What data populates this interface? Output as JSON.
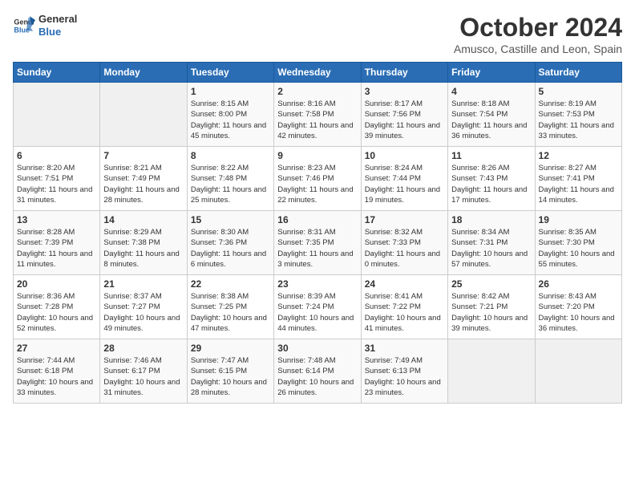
{
  "header": {
    "logo_general": "General",
    "logo_blue": "Blue",
    "month": "October 2024",
    "location": "Amusco, Castille and Leon, Spain"
  },
  "days_of_week": [
    "Sunday",
    "Monday",
    "Tuesday",
    "Wednesday",
    "Thursday",
    "Friday",
    "Saturday"
  ],
  "weeks": [
    [
      {
        "day": "",
        "sunrise": "",
        "sunset": "",
        "daylight": ""
      },
      {
        "day": "",
        "sunrise": "",
        "sunset": "",
        "daylight": ""
      },
      {
        "day": "1",
        "sunrise": "Sunrise: 8:15 AM",
        "sunset": "Sunset: 8:00 PM",
        "daylight": "Daylight: 11 hours and 45 minutes."
      },
      {
        "day": "2",
        "sunrise": "Sunrise: 8:16 AM",
        "sunset": "Sunset: 7:58 PM",
        "daylight": "Daylight: 11 hours and 42 minutes."
      },
      {
        "day": "3",
        "sunrise": "Sunrise: 8:17 AM",
        "sunset": "Sunset: 7:56 PM",
        "daylight": "Daylight: 11 hours and 39 minutes."
      },
      {
        "day": "4",
        "sunrise": "Sunrise: 8:18 AM",
        "sunset": "Sunset: 7:54 PM",
        "daylight": "Daylight: 11 hours and 36 minutes."
      },
      {
        "day": "5",
        "sunrise": "Sunrise: 8:19 AM",
        "sunset": "Sunset: 7:53 PM",
        "daylight": "Daylight: 11 hours and 33 minutes."
      }
    ],
    [
      {
        "day": "6",
        "sunrise": "Sunrise: 8:20 AM",
        "sunset": "Sunset: 7:51 PM",
        "daylight": "Daylight: 11 hours and 31 minutes."
      },
      {
        "day": "7",
        "sunrise": "Sunrise: 8:21 AM",
        "sunset": "Sunset: 7:49 PM",
        "daylight": "Daylight: 11 hours and 28 minutes."
      },
      {
        "day": "8",
        "sunrise": "Sunrise: 8:22 AM",
        "sunset": "Sunset: 7:48 PM",
        "daylight": "Daylight: 11 hours and 25 minutes."
      },
      {
        "day": "9",
        "sunrise": "Sunrise: 8:23 AM",
        "sunset": "Sunset: 7:46 PM",
        "daylight": "Daylight: 11 hours and 22 minutes."
      },
      {
        "day": "10",
        "sunrise": "Sunrise: 8:24 AM",
        "sunset": "Sunset: 7:44 PM",
        "daylight": "Daylight: 11 hours and 19 minutes."
      },
      {
        "day": "11",
        "sunrise": "Sunrise: 8:26 AM",
        "sunset": "Sunset: 7:43 PM",
        "daylight": "Daylight: 11 hours and 17 minutes."
      },
      {
        "day": "12",
        "sunrise": "Sunrise: 8:27 AM",
        "sunset": "Sunset: 7:41 PM",
        "daylight": "Daylight: 11 hours and 14 minutes."
      }
    ],
    [
      {
        "day": "13",
        "sunrise": "Sunrise: 8:28 AM",
        "sunset": "Sunset: 7:39 PM",
        "daylight": "Daylight: 11 hours and 11 minutes."
      },
      {
        "day": "14",
        "sunrise": "Sunrise: 8:29 AM",
        "sunset": "Sunset: 7:38 PM",
        "daylight": "Daylight: 11 hours and 8 minutes."
      },
      {
        "day": "15",
        "sunrise": "Sunrise: 8:30 AM",
        "sunset": "Sunset: 7:36 PM",
        "daylight": "Daylight: 11 hours and 6 minutes."
      },
      {
        "day": "16",
        "sunrise": "Sunrise: 8:31 AM",
        "sunset": "Sunset: 7:35 PM",
        "daylight": "Daylight: 11 hours and 3 minutes."
      },
      {
        "day": "17",
        "sunrise": "Sunrise: 8:32 AM",
        "sunset": "Sunset: 7:33 PM",
        "daylight": "Daylight: 11 hours and 0 minutes."
      },
      {
        "day": "18",
        "sunrise": "Sunrise: 8:34 AM",
        "sunset": "Sunset: 7:31 PM",
        "daylight": "Daylight: 10 hours and 57 minutes."
      },
      {
        "day": "19",
        "sunrise": "Sunrise: 8:35 AM",
        "sunset": "Sunset: 7:30 PM",
        "daylight": "Daylight: 10 hours and 55 minutes."
      }
    ],
    [
      {
        "day": "20",
        "sunrise": "Sunrise: 8:36 AM",
        "sunset": "Sunset: 7:28 PM",
        "daylight": "Daylight: 10 hours and 52 minutes."
      },
      {
        "day": "21",
        "sunrise": "Sunrise: 8:37 AM",
        "sunset": "Sunset: 7:27 PM",
        "daylight": "Daylight: 10 hours and 49 minutes."
      },
      {
        "day": "22",
        "sunrise": "Sunrise: 8:38 AM",
        "sunset": "Sunset: 7:25 PM",
        "daylight": "Daylight: 10 hours and 47 minutes."
      },
      {
        "day": "23",
        "sunrise": "Sunrise: 8:39 AM",
        "sunset": "Sunset: 7:24 PM",
        "daylight": "Daylight: 10 hours and 44 minutes."
      },
      {
        "day": "24",
        "sunrise": "Sunrise: 8:41 AM",
        "sunset": "Sunset: 7:22 PM",
        "daylight": "Daylight: 10 hours and 41 minutes."
      },
      {
        "day": "25",
        "sunrise": "Sunrise: 8:42 AM",
        "sunset": "Sunset: 7:21 PM",
        "daylight": "Daylight: 10 hours and 39 minutes."
      },
      {
        "day": "26",
        "sunrise": "Sunrise: 8:43 AM",
        "sunset": "Sunset: 7:20 PM",
        "daylight": "Daylight: 10 hours and 36 minutes."
      }
    ],
    [
      {
        "day": "27",
        "sunrise": "Sunrise: 7:44 AM",
        "sunset": "Sunset: 6:18 PM",
        "daylight": "Daylight: 10 hours and 33 minutes."
      },
      {
        "day": "28",
        "sunrise": "Sunrise: 7:46 AM",
        "sunset": "Sunset: 6:17 PM",
        "daylight": "Daylight: 10 hours and 31 minutes."
      },
      {
        "day": "29",
        "sunrise": "Sunrise: 7:47 AM",
        "sunset": "Sunset: 6:15 PM",
        "daylight": "Daylight: 10 hours and 28 minutes."
      },
      {
        "day": "30",
        "sunrise": "Sunrise: 7:48 AM",
        "sunset": "Sunset: 6:14 PM",
        "daylight": "Daylight: 10 hours and 26 minutes."
      },
      {
        "day": "31",
        "sunrise": "Sunrise: 7:49 AM",
        "sunset": "Sunset: 6:13 PM",
        "daylight": "Daylight: 10 hours and 23 minutes."
      },
      {
        "day": "",
        "sunrise": "",
        "sunset": "",
        "daylight": ""
      },
      {
        "day": "",
        "sunrise": "",
        "sunset": "",
        "daylight": ""
      }
    ]
  ]
}
